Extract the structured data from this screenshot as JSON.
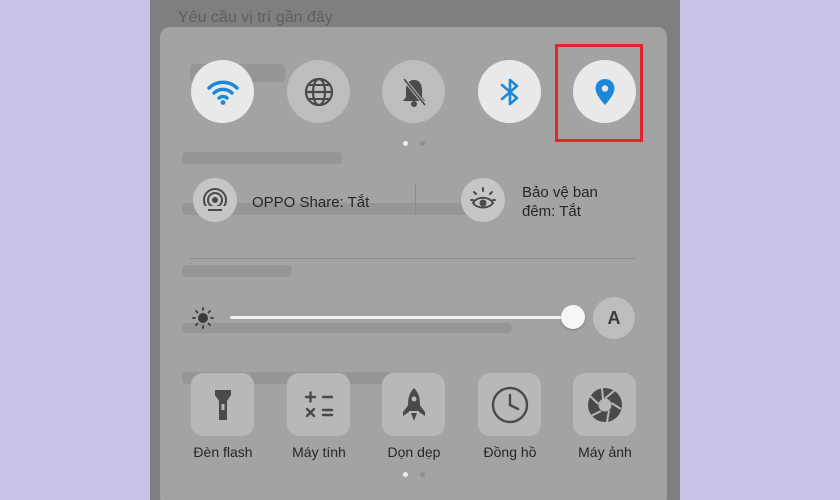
{
  "background_text": "Yêu cầu vị trí gần đây",
  "quick_toggles": [
    {
      "name": "wifi",
      "icon": "wifi-icon",
      "state": "on"
    },
    {
      "name": "data",
      "icon": "globe-icon",
      "state": "off"
    },
    {
      "name": "silent",
      "icon": "bell-off-icon",
      "state": "off"
    },
    {
      "name": "bluetooth",
      "icon": "bluetooth-icon",
      "state": "on"
    },
    {
      "name": "location",
      "icon": "location-pin-icon",
      "state": "on",
      "highlighted": true
    }
  ],
  "page_indicator": {
    "pages": 2,
    "current": 1
  },
  "oppo_share": {
    "label": "OPPO Share: Tắt",
    "icon": "share-icon"
  },
  "night_shield": {
    "label_line1": "Bảo vệ ban",
    "label_line2": "đêm: Tắt",
    "icon": "eye-shield-icon"
  },
  "brightness": {
    "level": 0.98,
    "auto_label": "A",
    "icon": "sun-icon"
  },
  "tools": [
    {
      "label": "Đèn flash",
      "icon": "flashlight-icon"
    },
    {
      "label": "Máy tính",
      "icon": "calculator-icon"
    },
    {
      "label": "Dọn dẹp",
      "icon": "rocket-icon"
    },
    {
      "label": "Đồng hồ",
      "icon": "clock-icon"
    },
    {
      "label": "Máy ảnh",
      "icon": "camera-aperture-icon"
    }
  ],
  "colors": {
    "accent": "#1e88d8",
    "highlight": "#e3262b",
    "page_background": "#c9c1e6"
  }
}
